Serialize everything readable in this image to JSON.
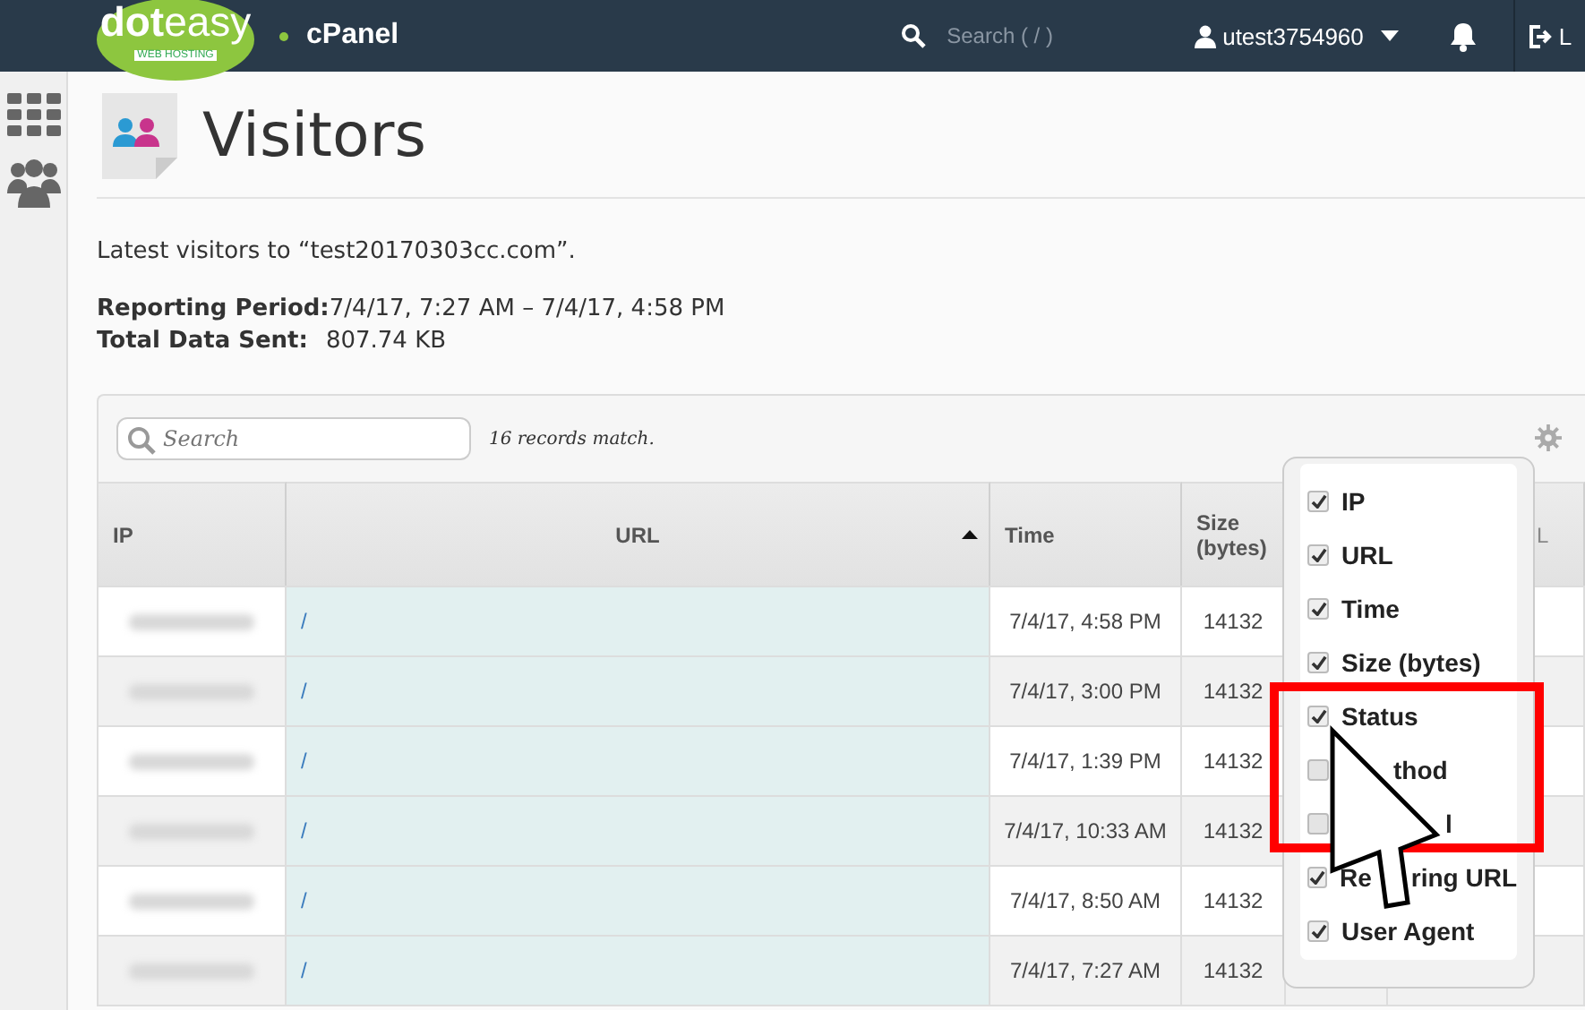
{
  "header": {
    "logo": "dot",
    "logo_accent": "easy",
    "logo_sub": "WEB HOSTING",
    "product": "cPanel",
    "search": {
      "placeholder": "Search ( / )"
    },
    "user": "utest3754960",
    "logout": "L"
  },
  "page": {
    "title": "Visitors",
    "intro": "Latest visitors to “test20170303cc.com”.",
    "period_label": "Reporting Period:",
    "period_value": "7/4/17, 7:27 AM  –  7/4/17, 4:58 PM",
    "sent_label": "Total Data Sent:",
    "sent_value": "807.74 KB"
  },
  "table": {
    "search": {
      "placeholder": "Search"
    },
    "match_count": "16 records match.",
    "columns": [
      {
        "label": "IP",
        "sorted": false
      },
      {
        "label": "URL",
        "sorted": true
      },
      {
        "label": "Time",
        "sorted": false
      },
      {
        "label": "Size (bytes)",
        "sorted": false
      },
      {
        "label": "L",
        "sorted": false
      }
    ],
    "rows": [
      {
        "url": "/",
        "time": "7/4/17, 4:58 PM",
        "size": "14132"
      },
      {
        "url": "/",
        "time": "7/4/17, 3:00 PM",
        "size": "14132"
      },
      {
        "url": "/",
        "time": "7/4/17, 1:39 PM",
        "size": "14132"
      },
      {
        "url": "/",
        "time": "7/4/17, 10:33 AM",
        "size": "14132"
      },
      {
        "url": "/",
        "time": "7/4/17, 8:50 AM",
        "size": "14132"
      },
      {
        "url": "/",
        "time": "7/4/17, 7:27 AM",
        "size": "14132"
      }
    ]
  },
  "column_menu": {
    "items": [
      {
        "kind": "full",
        "parts": [
          "IP"
        ],
        "checked": true
      },
      {
        "kind": "full",
        "parts": [
          "URL"
        ],
        "checked": true
      },
      {
        "kind": "full",
        "parts": [
          "Time"
        ],
        "checked": true
      },
      {
        "kind": "full",
        "parts": [
          "Size (bytes)"
        ],
        "checked": true
      },
      {
        "kind": "full",
        "parts": [
          "Status"
        ],
        "checked": true
      },
      {
        "kind": "covered",
        "parts": [
          "thod"
        ],
        "checked": false
      },
      {
        "kind": "covered",
        "parts": [
          "l"
        ],
        "checked": false
      },
      {
        "kind": "covered",
        "parts": [
          "Re",
          "ring URL"
        ],
        "checked": true
      },
      {
        "kind": "full",
        "parts": [
          "User Agent"
        ],
        "checked": true
      }
    ]
  }
}
